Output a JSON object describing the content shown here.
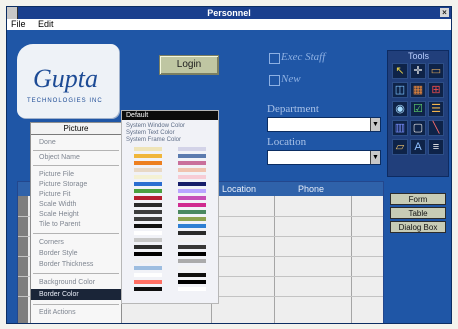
{
  "window": {
    "title": "Personnel"
  },
  "menu": {
    "file": "File",
    "edit": "Edit"
  },
  "logo": {
    "word": "Gupta",
    "sub": "TECHNOLOGIES INC"
  },
  "form": {
    "login": "Login",
    "checkboxes": [
      {
        "label": "Exec Staff"
      },
      {
        "label": "New"
      }
    ],
    "department_label": "Department",
    "location_label": "Location"
  },
  "table": {
    "columns": [
      "Location",
      "Phone"
    ]
  },
  "context_menu": {
    "title": "Picture",
    "items": [
      "Done",
      "Object Name",
      "Picture File",
      "Picture Storage",
      "Picture Fit",
      "Scale Width",
      "Scale Height",
      "Tile to Parent",
      "Corners",
      "Border Style",
      "Border Thickness",
      "Background Color",
      "Border Color",
      "Edit Actions"
    ],
    "selected": "Border Color"
  },
  "palette": {
    "header": "Default",
    "options": [
      "System Window Color",
      "System Text Color",
      "System Frame Color"
    ],
    "colors_left": [
      "#efe4b8",
      "#f0b63b",
      "#ed7f1f",
      "#e8d8c5",
      "#f4f1d4",
      "#2b6dd0",
      "#4ca13f",
      "#b51f2f",
      "#2a2a2a",
      "#3d3d3d",
      "#3f3f3f",
      "#111111",
      "#ffffff",
      "#c7c7c7",
      "#2d2d2d",
      "#000000",
      "#f1f1f1",
      "#9dbde0",
      "#fefefe",
      "#ff6f63",
      "#0e0e0e"
    ],
    "colors_right": [
      "#d3d3e8",
      "#5b7aae",
      "#c96f9b",
      "#f0c3b0",
      "#f7ccd5",
      "#151d69",
      "#b8a5ff",
      "#c64fb7",
      "#d02b90",
      "#4a8860",
      "#8da34f",
      "#2f7fd3",
      "#2a2a2a",
      "#f1f1f1",
      "#383838",
      "#000000",
      "#ababab",
      "#f3f3f3",
      "#0f0f0f",
      "#000000",
      "#ffffff"
    ]
  },
  "toolbox": {
    "title": "Tools",
    "buttons": [
      "select",
      "crosshair",
      "combo",
      "image",
      "button",
      "grid",
      "radio",
      "checkbox",
      "listbox",
      "scrollbar",
      "frame",
      "line",
      "field",
      "label",
      "multiline"
    ]
  },
  "tool_group": [
    "Form",
    "Table",
    "Dialog Box"
  ]
}
